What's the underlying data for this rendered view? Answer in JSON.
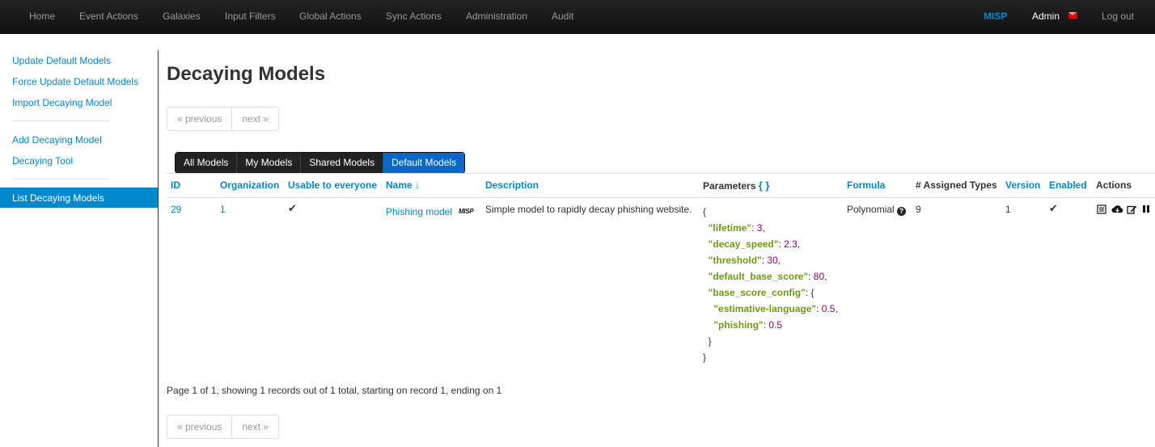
{
  "nav": {
    "items": [
      "Home",
      "Event Actions",
      "Galaxies",
      "Input Filters",
      "Global Actions",
      "Sync Actions",
      "Administration",
      "Audit"
    ],
    "brand": "MISP",
    "user": "Admin",
    "logout": "Log out",
    "colors": {
      "brand": "#0088cc",
      "mail": "#e00000"
    }
  },
  "sidebar": {
    "items": [
      "Update Default Models",
      "Force Update Default Models",
      "Import Decaying Model",
      "Add Decaying Model",
      "Decaying Tool",
      "List Decaying Models"
    ]
  },
  "page": {
    "title": "Decaying Models",
    "pager": {
      "previous": "« previous",
      "next": "next »"
    },
    "tabs": [
      "All Models",
      "My Models",
      "Shared Models",
      "Default Models"
    ],
    "active_tab": "Default Models",
    "summary": "Page 1 of 1, showing 1 records out of 1 total, starting on record 1, ending on 1"
  },
  "table": {
    "headers": {
      "id": "ID",
      "org": "Organization",
      "usable": "Usable to everyone",
      "name": "Name ↓",
      "description": "Description",
      "parameters": "Parameters",
      "parameters_braces": "{ }",
      "formula": "Formula",
      "assigned": "# Assigned Types",
      "version": "Version",
      "enabled": "Enabled",
      "actions": "Actions"
    },
    "rows": [
      {
        "id": "29",
        "org": "1",
        "usable": "✔",
        "name": "Phishing model",
        "name_badge": "MISP",
        "description": "Simple model to rapidly decay phishing website.",
        "formula": "Polynomial",
        "assigned": "9",
        "version": "1",
        "enabled": "✔",
        "parameters": [
          {
            "indent": "",
            "k": "",
            "v": "{",
            "t": ""
          },
          {
            "indent": "  ",
            "k": "\"lifetime\"",
            "v": "3",
            "t": ","
          },
          {
            "indent": "  ",
            "k": "\"decay_speed\"",
            "v": "2.3",
            "t": ","
          },
          {
            "indent": "  ",
            "k": "\"threshold\"",
            "v": "30",
            "t": ","
          },
          {
            "indent": "  ",
            "k": "\"default_base_score\"",
            "v": "80",
            "t": ","
          },
          {
            "indent": "  ",
            "k": "\"base_score_config\"",
            "v": "",
            "t": "{"
          },
          {
            "indent": "    ",
            "k": "\"estimative-language\"",
            "v": "0.5",
            "t": ","
          },
          {
            "indent": "    ",
            "k": "\"phishing\"",
            "v": "0.5",
            "t": ""
          },
          {
            "indent": "  ",
            "k": "",
            "v": "}",
            "t": ""
          },
          {
            "indent": "",
            "k": "",
            "v": "}",
            "t": ""
          }
        ],
        "actions": [
          "view-icon",
          "export-icon",
          "edit-icon",
          "pause-icon"
        ]
      }
    ]
  }
}
